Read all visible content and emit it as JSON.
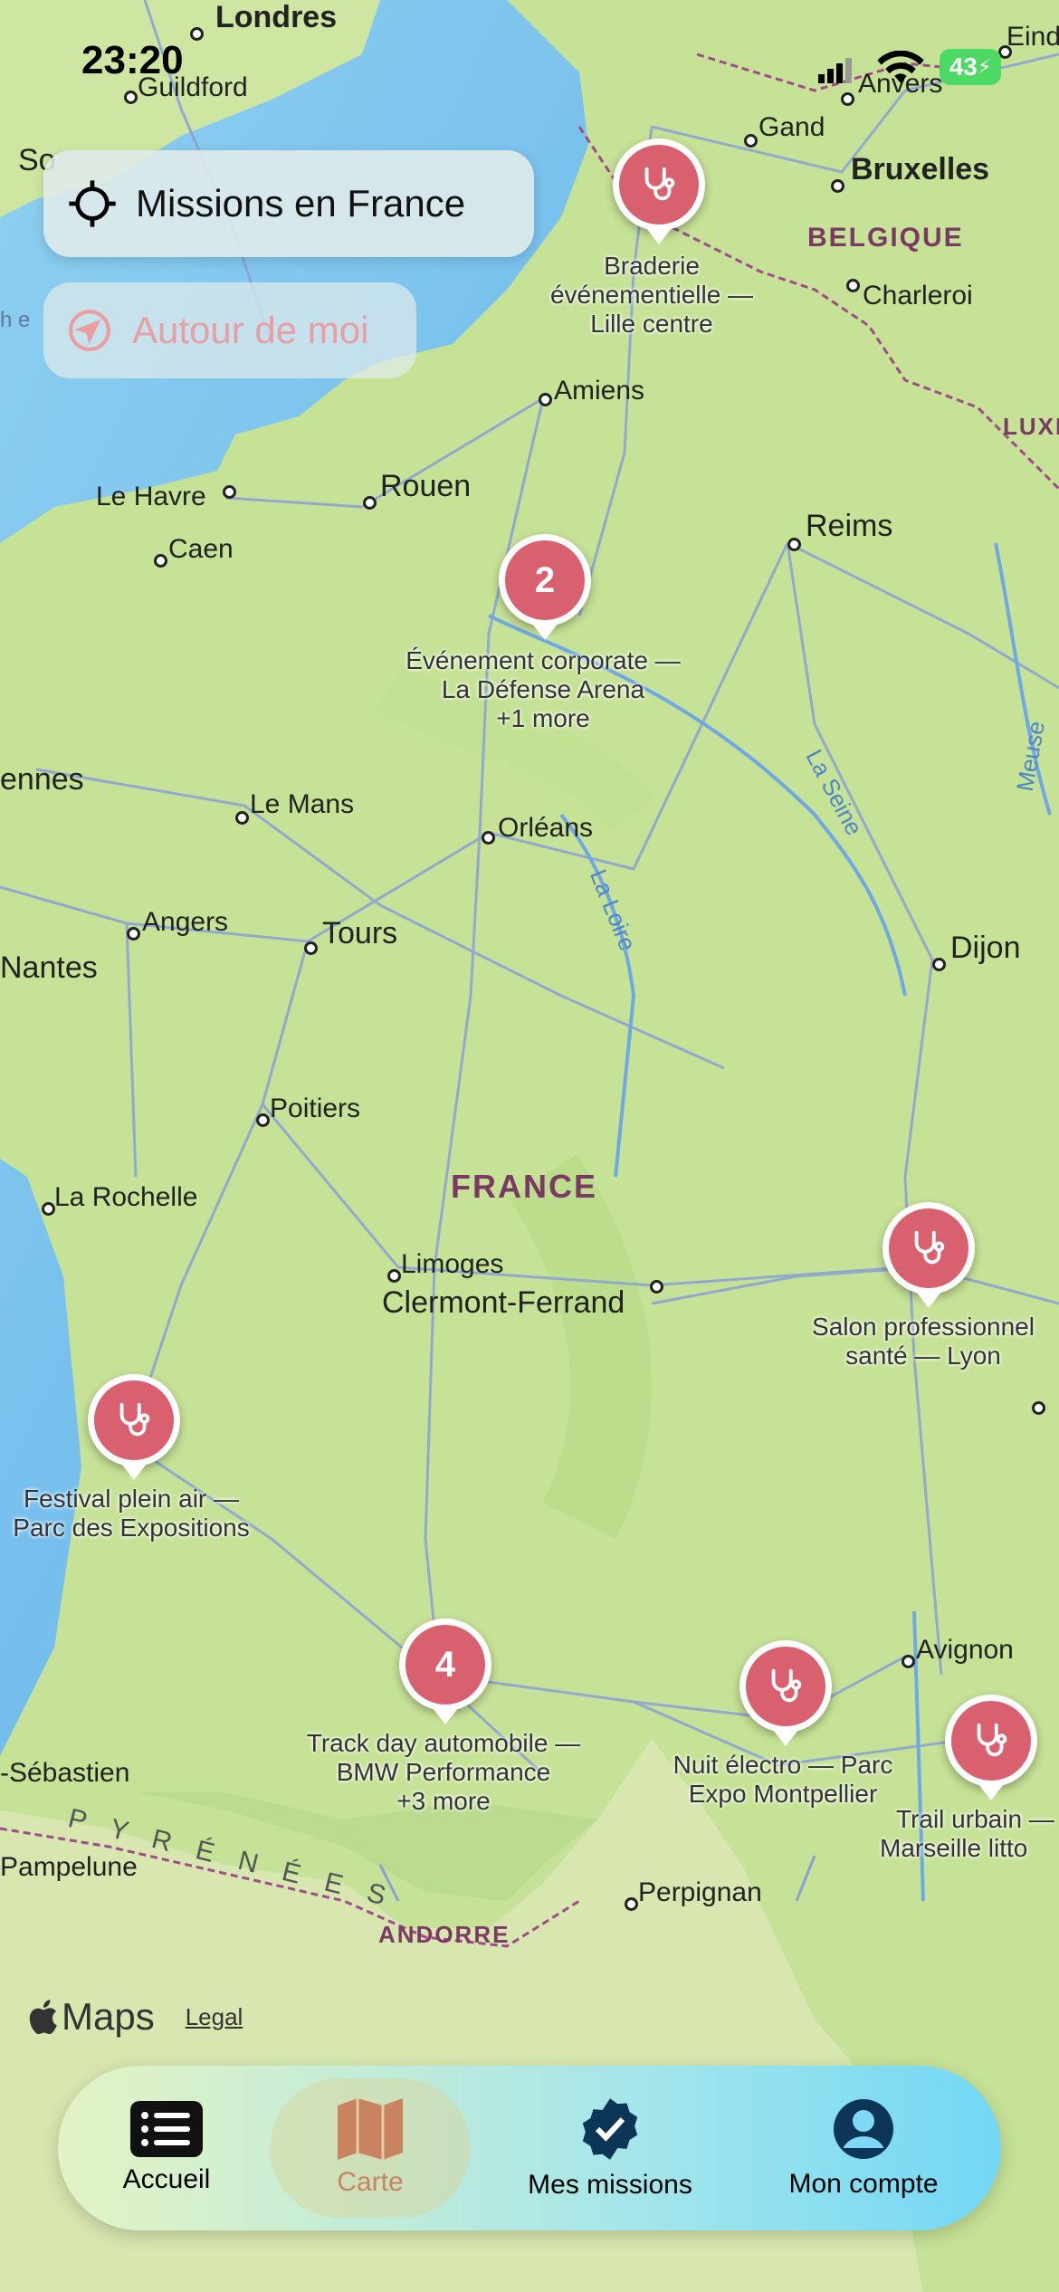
{
  "status_bar": {
    "time": "23:20",
    "battery": "43"
  },
  "controls": {
    "missions_label": "Missions en France",
    "nearby_label": "Autour de moi"
  },
  "map": {
    "cities": {
      "londres": "Londres",
      "guildford": "Guildford",
      "anvers": "Anvers",
      "gand": "Gand",
      "bruxelles": "Bruxelles",
      "charleroi": "Charleroi",
      "eind": "Eind",
      "amiens": "Amiens",
      "le_havre": "Le Havre",
      "rouen": "Rouen",
      "caen": "Caen",
      "reims": "Reims",
      "rennes": "ennes",
      "le_mans": "Le Mans",
      "orleans": "Orléans",
      "angers": "Angers",
      "tours": "Tours",
      "nantes": "Nantes",
      "dijon": "Dijon",
      "poitiers": "Poitiers",
      "la_rochelle": "La Rochelle",
      "limoges": "Limoges",
      "clermont": "Clermont-Ferrand",
      "avignon": "Avignon",
      "perpignan": "Perpignan",
      "san_sebastian": "-Sébastien",
      "pampelune": "Pampelune",
      "so": "So",
      "he": "h e"
    },
    "countries": {
      "belgique": "BELGIQUE",
      "lux": "LUXE",
      "france": "FRANCE",
      "andorre": "ANDORRE",
      "pyrenees": "P Y R É N É E S"
    },
    "rivers": {
      "seine": "La Seine",
      "loire": "La Loire",
      "meuse": "Meuse"
    },
    "attribution": {
      "brand": "Maps",
      "legal": "Legal"
    }
  },
  "pins": [
    {
      "badge": "",
      "line1": "Braderie",
      "line2": "événementielle —",
      "line3": "Lille centre"
    },
    {
      "badge": "2",
      "line1": "Événement corporate —",
      "line2": "La Défense Arena",
      "line3": "+1 more"
    },
    {
      "badge": "",
      "line1": "Salon professionnel",
      "line2": "santé — Lyon",
      "line3": ""
    },
    {
      "badge": "",
      "line1": "Festival plein air —",
      "line2": "Parc des Expositions",
      "line3": ""
    },
    {
      "badge": "4",
      "line1": "Track day automobile —",
      "line2": "BMW Performance",
      "line3": "+3 more"
    },
    {
      "badge": "",
      "line1": "Nuit électro — Parc",
      "line2": "Expo Montpellier",
      "line3": ""
    },
    {
      "badge": "",
      "line1": "Trail urbain —",
      "line2": "Marseille litto",
      "line3": ""
    }
  ],
  "tabs": [
    {
      "label": "Accueil",
      "icon": "list-icon"
    },
    {
      "label": "Carte",
      "icon": "map-icon"
    },
    {
      "label": "Mes missions",
      "icon": "badge-check-icon"
    },
    {
      "label": "Mon compte",
      "icon": "account-icon"
    }
  ],
  "colors": {
    "pin": "#d9606f",
    "land": "#c9e39b",
    "sea": "#7fc3ee",
    "active_tab": "#c8845e"
  }
}
